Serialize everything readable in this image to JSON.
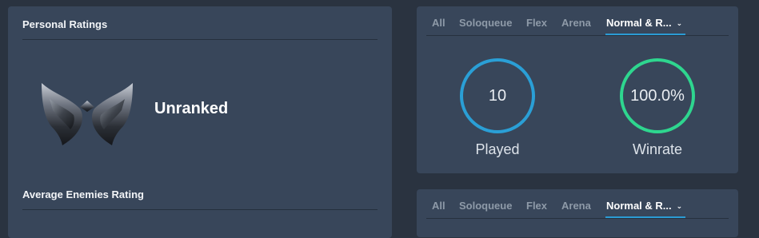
{
  "personal_ratings": {
    "title": "Personal Ratings",
    "rank_label": "Unranked",
    "emblem_icon": "unranked-emblem-icon"
  },
  "average_enemies": {
    "title": "Average Enemies Rating"
  },
  "queue_tabs": [
    {
      "label": "All"
    },
    {
      "label": "Soloqueue"
    },
    {
      "label": "Flex"
    },
    {
      "label": "Arena"
    },
    {
      "label": "Normal & R...",
      "active": true
    }
  ],
  "stats": {
    "played": {
      "value": "10",
      "label": "Played"
    },
    "winrate": {
      "value": "100.0%",
      "label": "Winrate"
    }
  },
  "colors": {
    "played_ring": "#2a9fd6",
    "winrate_ring": "#2ed68f",
    "active_tab_underline": "#2b9bd4"
  }
}
